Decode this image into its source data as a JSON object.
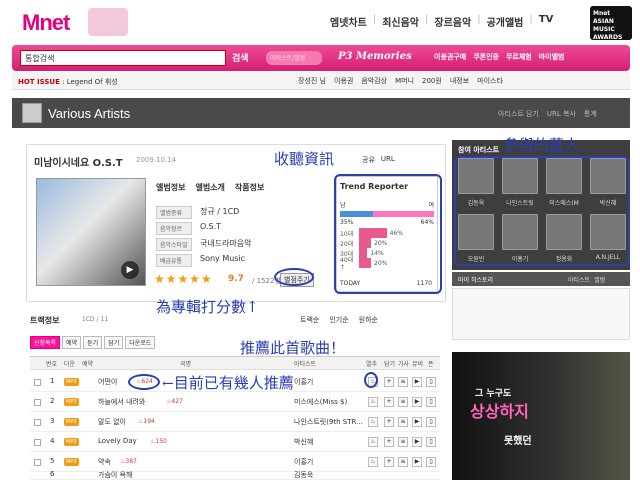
{
  "header": {
    "logo": "Mnet",
    "nav": [
      "엠넷차트",
      "최신음악",
      "장르음악",
      "공개앨범",
      "TV"
    ],
    "award": "Mnet ASIAN MUSIC AWARDS"
  },
  "search": {
    "select_label": "통합검색",
    "button": "검색",
    "artist_select": "아티스트/앨범",
    "p3": "P3 Memories",
    "links": [
      "이용권구매",
      "쿠폰인증",
      "무료체험",
      "마이앨범"
    ]
  },
  "hotissue": {
    "label": "HOT ISSUE",
    "text": ": Legend Of 휘성",
    "right": [
      "장성진 님",
      "이용권",
      "음악감상",
      "M머니",
      "200원",
      "내정보",
      "마이스타"
    ]
  },
  "page": {
    "title": "Various Artists",
    "right_links": [
      "아티스트 담기",
      "URL 복사",
      "통계"
    ]
  },
  "album": {
    "title": "미남이시네요 O.S.T",
    "date": "2009.10.14",
    "tabs": [
      "앨범정보",
      "앨범소개",
      "작품정보"
    ],
    "info": [
      {
        "k": "앨범종류",
        "v": "정규 / 1CD"
      },
      {
        "k": "음악장르",
        "v": "O.S.T"
      },
      {
        "k": "음악스타일",
        "v": "국내드라마음악"
      },
      {
        "k": "배급유통",
        "v": "Sony Music"
      }
    ],
    "stars": "★★★★★",
    "score": "9.7",
    "votes": "/ 1522명",
    "rate_button": "별점주기",
    "top_links": [
      "공유",
      "URL"
    ]
  },
  "trend": {
    "title": "Trend Reporter",
    "male_label": "남",
    "female_label": "여",
    "male_pct": "35%",
    "female_pct": "64%",
    "male_fraction": 0.35,
    "ages": [
      {
        "age": "10대",
        "pct": "46%",
        "fraction": 0.46
      },
      {
        "age": "20대",
        "pct": "20%",
        "fraction": 0.2
      },
      {
        "age": "30대",
        "pct": "14%",
        "fraction": 0.14
      },
      {
        "age": "40대↑",
        "pct": "20%",
        "fraction": 0.2
      }
    ],
    "total_label": "TODAY",
    "total_value": "1170"
  },
  "sidebar": {
    "title": "참여 아티스트",
    "artists": [
      "김동욱",
      "나인스트릿",
      "미스에스(M",
      "박신혜",
      "오원빈",
      "이홍기",
      "정용화",
      "A.N.JELL"
    ],
    "history_title": "마이 히스토리",
    "history_links": [
      "아티스트",
      "앨범"
    ]
  },
  "ad": {
    "line1": "그 누구도",
    "line2": "상상하지",
    "line3": "못했던"
  },
  "tracks": {
    "title": "트랙정보",
    "count": "1CD / 11",
    "sort": [
      "트랙순",
      "인기순",
      "원하순"
    ],
    "buttons": [
      "신청목록",
      "예약",
      "듣기",
      "담기",
      "다운로드"
    ],
    "headers": [
      "번호",
      "다운",
      "예약",
      "곡명",
      "아티스트",
      "열추",
      "담기",
      "가사",
      "뮤비",
      "폰"
    ],
    "rows": [
      {
        "no": "1",
        "title": "어떤이",
        "count": "624",
        "artist": "이홍기"
      },
      {
        "no": "2",
        "title": "하늘에서 내려와",
        "count": "427",
        "artist": "미스에스(Miss $)"
      },
      {
        "no": "3",
        "title": "말도 없이",
        "count": "194",
        "artist": "나인스트릿(9th STR..."
      },
      {
        "no": "4",
        "title": "Lovely Day",
        "count": "150",
        "artist": "박신혜"
      },
      {
        "no": "5",
        "title": "약속",
        "count": "387",
        "artist": "이홍기"
      },
      {
        "no": "6",
        "title": "가슴이 욕해",
        "count": "",
        "artist": "김동욱"
      }
    ],
    "mp3": "MP3"
  },
  "annotations": {
    "listen_info": "收聽資訊",
    "participating": "參與的藝人",
    "rate": "為專輯打分數↑",
    "recommend": "推薦此首歌曲！",
    "how_many": "目前已有幾人推薦"
  }
}
